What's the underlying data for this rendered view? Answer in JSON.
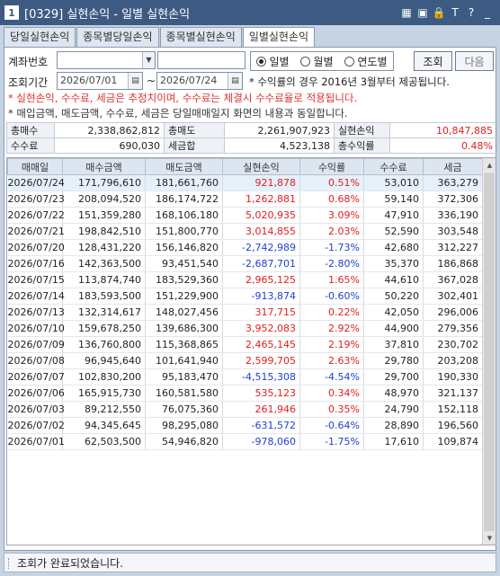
{
  "window": {
    "screen_no": "1",
    "title": "[0329] 실현손익 - 일별 실현손익",
    "icons": [
      "pin-icon",
      "tile-icon",
      "lock-icon",
      "font-icon",
      "help-icon",
      "minimize-icon"
    ]
  },
  "tabs": [
    "당일실현손익",
    "종목별당일손익",
    "종목별실현손익",
    "일별실현손익"
  ],
  "active_tab": 3,
  "form": {
    "account_label": "계좌번호",
    "account_value": "",
    "period_label": "조회기간",
    "date_from": "2026/07/01",
    "tilde": "~",
    "date_to": "2026/07/24",
    "period_note": "* 수익률의 경우 2016년 3월부터 제공됩니다.",
    "radios": [
      "일별",
      "월별",
      "연도별"
    ],
    "radio_selected": 0,
    "search_button": "조회",
    "next_button": "다음"
  },
  "notes": {
    "red": "* 실현손익, 수수료, 세금은 추정치이며, 수수료는 체결시 수수료율로 적용됩니다.",
    "dark": "* 매입금액, 매도금액, 수수료, 세금은 당일매매일지 화면의 내용과 동일합니다."
  },
  "summary": {
    "total_buy_label": "총매수",
    "total_buy": "2,338,862,812",
    "total_sell_label": "총매도",
    "total_sell": "2,261,907,923",
    "realized_label": "실현손익",
    "realized": "10,847,885",
    "fee_label": "수수료",
    "fee": "690,030",
    "tax_label": "세금합",
    "tax": "4,523,138",
    "rate_label": "총수익률",
    "rate": "0.48%"
  },
  "grid": {
    "headers": [
      "매매일",
      "매수금액",
      "매도금액",
      "실현손익",
      "수익률",
      "수수료",
      "세금"
    ],
    "rows": [
      [
        "2026/07/24",
        "171,796,610",
        "181,661,760",
        "921,878",
        "0.51%",
        "53,010",
        "363,279"
      ],
      [
        "2026/07/23",
        "208,094,520",
        "186,174,722",
        "1,262,881",
        "0.68%",
        "59,140",
        "372,306"
      ],
      [
        "2026/07/22",
        "151,359,280",
        "168,106,180",
        "5,020,935",
        "3.09%",
        "47,910",
        "336,190"
      ],
      [
        "2026/07/21",
        "198,842,510",
        "151,800,770",
        "3,014,855",
        "2.03%",
        "52,590",
        "303,548"
      ],
      [
        "2026/07/20",
        "128,431,220",
        "156,146,820",
        "-2,742,989",
        "-1.73%",
        "42,680",
        "312,227"
      ],
      [
        "2026/07/16",
        "142,363,500",
        "93,451,540",
        "-2,687,701",
        "-2.80%",
        "35,370",
        "186,868"
      ],
      [
        "2026/07/15",
        "113,874,740",
        "183,529,360",
        "2,965,125",
        "1.65%",
        "44,610",
        "367,028"
      ],
      [
        "2026/07/14",
        "183,593,500",
        "151,229,900",
        "-913,874",
        "-0.60%",
        "50,220",
        "302,401"
      ],
      [
        "2026/07/13",
        "132,314,617",
        "148,027,456",
        "317,715",
        "0.22%",
        "42,050",
        "296,006"
      ],
      [
        "2026/07/10",
        "159,678,250",
        "139,686,300",
        "3,952,083",
        "2.92%",
        "44,900",
        "279,356"
      ],
      [
        "2026/07/09",
        "136,760,800",
        "115,368,865",
        "2,465,145",
        "2.19%",
        "37,810",
        "230,702"
      ],
      [
        "2026/07/08",
        "96,945,640",
        "101,641,940",
        "2,599,705",
        "2.63%",
        "29,780",
        "203,208"
      ],
      [
        "2026/07/07",
        "102,830,200",
        "95,183,470",
        "-4,515,308",
        "-4.54%",
        "29,700",
        "190,330"
      ],
      [
        "2026/07/06",
        "165,915,730",
        "160,581,580",
        "535,123",
        "0.34%",
        "48,970",
        "321,137"
      ],
      [
        "2026/07/03",
        "89,212,550",
        "76,075,360",
        "261,946",
        "0.35%",
        "24,790",
        "152,118"
      ],
      [
        "2026/07/02",
        "94,345,645",
        "98,295,080",
        "-631,572",
        "-0.64%",
        "28,890",
        "196,560"
      ],
      [
        "2026/07/01",
        "62,503,500",
        "54,946,820",
        "-978,060",
        "-1.75%",
        "17,610",
        "109,874"
      ]
    ]
  },
  "status": "조회가 완료되었습니다.",
  "colors": {
    "titlebar": "#3d5b82",
    "positive": "#e02020",
    "negative": "#1f3fd0",
    "header": "#dde6f0"
  }
}
